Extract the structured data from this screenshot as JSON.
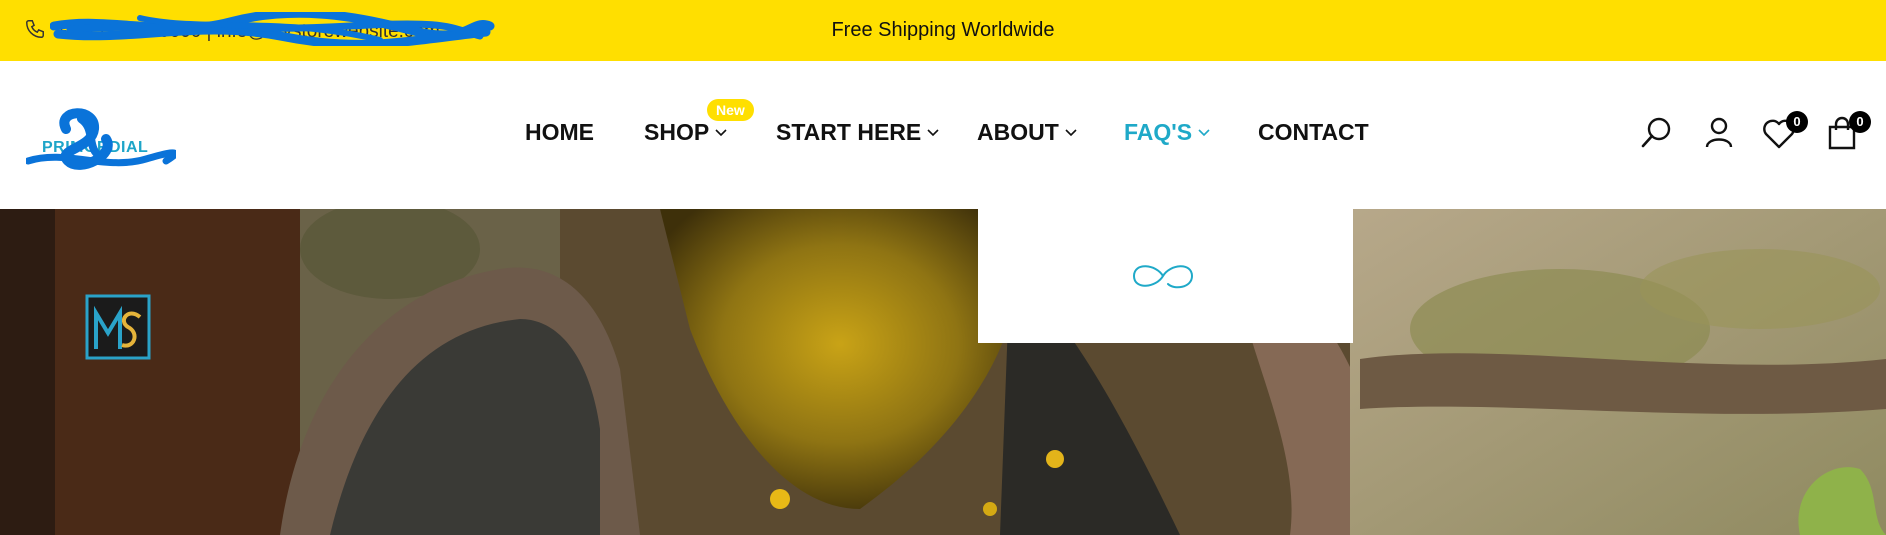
{
  "topbar": {
    "phone_text": "+1 357-951-0000 | info@mystorewebsite.com",
    "announcement": "Free Shipping Worldwide",
    "background": "#FFDF00"
  },
  "logo": {
    "text": "PRIMORDIAL"
  },
  "nav": {
    "items": [
      {
        "label": "HOME"
      },
      {
        "label": "SHOP",
        "badge": "New"
      },
      {
        "label": "START HERE"
      },
      {
        "label": "ABOUT"
      },
      {
        "label": "FAQ'S",
        "active": true
      },
      {
        "label": "CONTACT"
      }
    ],
    "accent": "#1FA9C8"
  },
  "header_icons": {
    "search": "search-icon",
    "account": "user-icon",
    "wishlist": "heart-icon",
    "wishlist_count": "0",
    "cart": "shopping-bag-icon",
    "cart_count": "0"
  },
  "dropdown": {
    "icon": "loading-infinity-icon"
  },
  "hero": {
    "watermark": "MS"
  }
}
